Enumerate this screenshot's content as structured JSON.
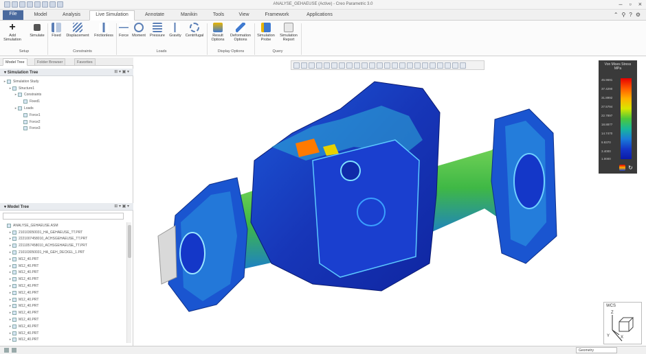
{
  "window": {
    "title": "ANALYSE_GEHAEUSE (Active) - Creo Parametric 3.0"
  },
  "menu": {
    "tabs": [
      "File",
      "Model",
      "Analysis",
      "Live Simulation",
      "Annotate",
      "Manikin",
      "Tools",
      "View",
      "Framework",
      "Applications"
    ],
    "active": "Live Simulation"
  },
  "ribbon": {
    "setup": {
      "label": "Setup",
      "buttons": [
        "Add\nSimulation",
        "Simulate"
      ]
    },
    "constraints": {
      "label": "Constraints",
      "buttons": [
        "Fixed",
        "Displacement",
        "Frictionless"
      ]
    },
    "loads": {
      "label": "Loads",
      "buttons": [
        "Force",
        "Moment",
        "Pressure",
        "Gravity",
        "Centrifugal"
      ]
    },
    "display": {
      "label": "Display Options",
      "buttons": [
        "Result\nOptions",
        "Deformation\nOptions"
      ]
    },
    "query": {
      "label": "Query",
      "buttons": [
        "Simulation\nProbe",
        "Simulation\nReport"
      ]
    }
  },
  "panel_tabs": [
    "Model Tree",
    "Folder Browser",
    "Favorites"
  ],
  "sim_tree": {
    "header": "Simulation Tree",
    "items": [
      {
        "label": "Simulation Study",
        "indent": 0
      },
      {
        "label": "Structure1",
        "indent": 1
      },
      {
        "label": "Constraints",
        "indent": 2
      },
      {
        "label": "Fixed1",
        "indent": 3
      },
      {
        "label": "Loads",
        "indent": 2
      },
      {
        "label": "Force1",
        "indent": 3
      },
      {
        "label": "Force2",
        "indent": 3
      },
      {
        "label": "Force3",
        "indent": 3
      }
    ]
  },
  "model_tree": {
    "header": "Model Tree",
    "items": [
      "ANALYSE_GEHAEUSE.ASM",
      "210103050031_HA_GEHAEUSE_TT.PRT",
      "2221007458010_ACHSGEHAEUSE_TT.PRT",
      "2211057458010_ACHSGEHAEUSE_TT.PRT",
      "210103050031_HA_GEH_DECKEL_1.PRT",
      "M12_40.PRT",
      "M12_40.PRT",
      "M12_40.PRT",
      "M12_40.PRT",
      "M12_40.PRT",
      "M12_40.PRT",
      "M12_40.PRT",
      "M12_40.PRT",
      "M12_40.PRT",
      "M12_40.PRT",
      "M12_40.PRT",
      "M12_40.PRT",
      "M12_40.PRT"
    ]
  },
  "legend": {
    "title": "Von Mises Stress\nMPa",
    "ticks": [
      "45.9691",
      "37.4290",
      "31.8992",
      "27.5794",
      "22.7897",
      "18.8877",
      "14.7470",
      "9.9370",
      "3.4000",
      "1.0000"
    ],
    "colors": [
      "#e60000",
      "#ff8a00",
      "#1437c8"
    ]
  },
  "triad": {
    "view": "WCS",
    "axes": [
      "Z",
      "X",
      "Y"
    ]
  },
  "status": {
    "display": "Geometry"
  }
}
